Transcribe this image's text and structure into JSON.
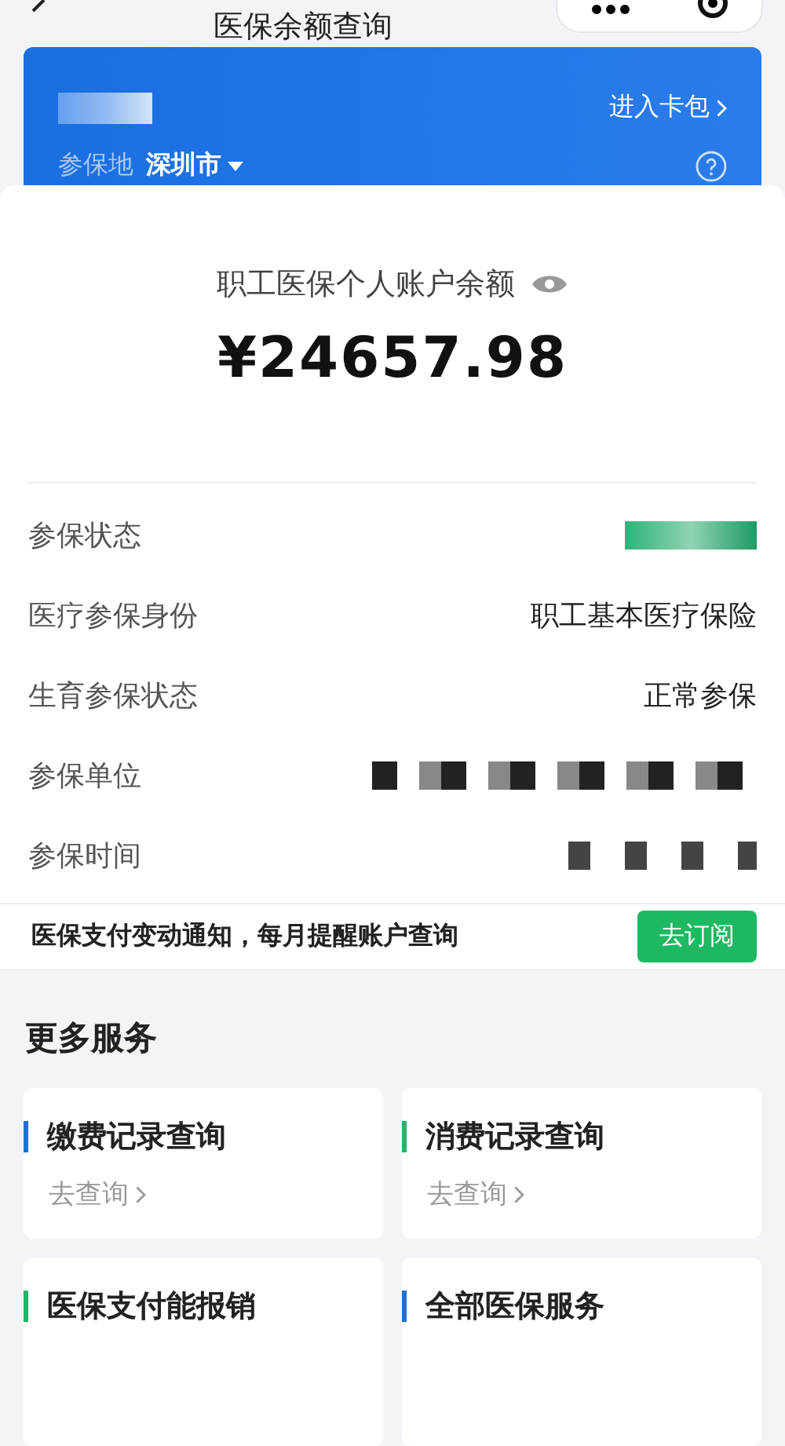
{
  "header": {
    "title": "医保余额查询"
  },
  "card": {
    "wallet_link": "进入卡包",
    "region_label": "参保地",
    "region": "深圳市"
  },
  "balance": {
    "label": "职工医保个人账户余额",
    "amount": "¥24657.98"
  },
  "details": [
    {
      "label": "参保状态",
      "kind": "redacted-status"
    },
    {
      "label": "医疗参保身份",
      "value": "职工基本医疗保险",
      "kind": "text"
    },
    {
      "label": "生育参保状态",
      "value": "正常参保",
      "kind": "text"
    },
    {
      "label": "参保单位",
      "kind": "redacted"
    },
    {
      "label": "参保时间",
      "kind": "redacted-short"
    }
  ],
  "notice": {
    "text": "医保支付变动通知，每月提醒账户查询",
    "button": "去订阅"
  },
  "services": {
    "title": "更多服务",
    "items": [
      {
        "title": "缴费记录查询",
        "link": "去查询",
        "color": "#1e6fd9"
      },
      {
        "title": "消费记录查询",
        "link": "去查询",
        "color": "#21b46a"
      },
      {
        "title": "医保支付能报销",
        "color": "#21b46a"
      },
      {
        "title": "全部医保服务",
        "color": "#1e6fd9"
      }
    ]
  }
}
